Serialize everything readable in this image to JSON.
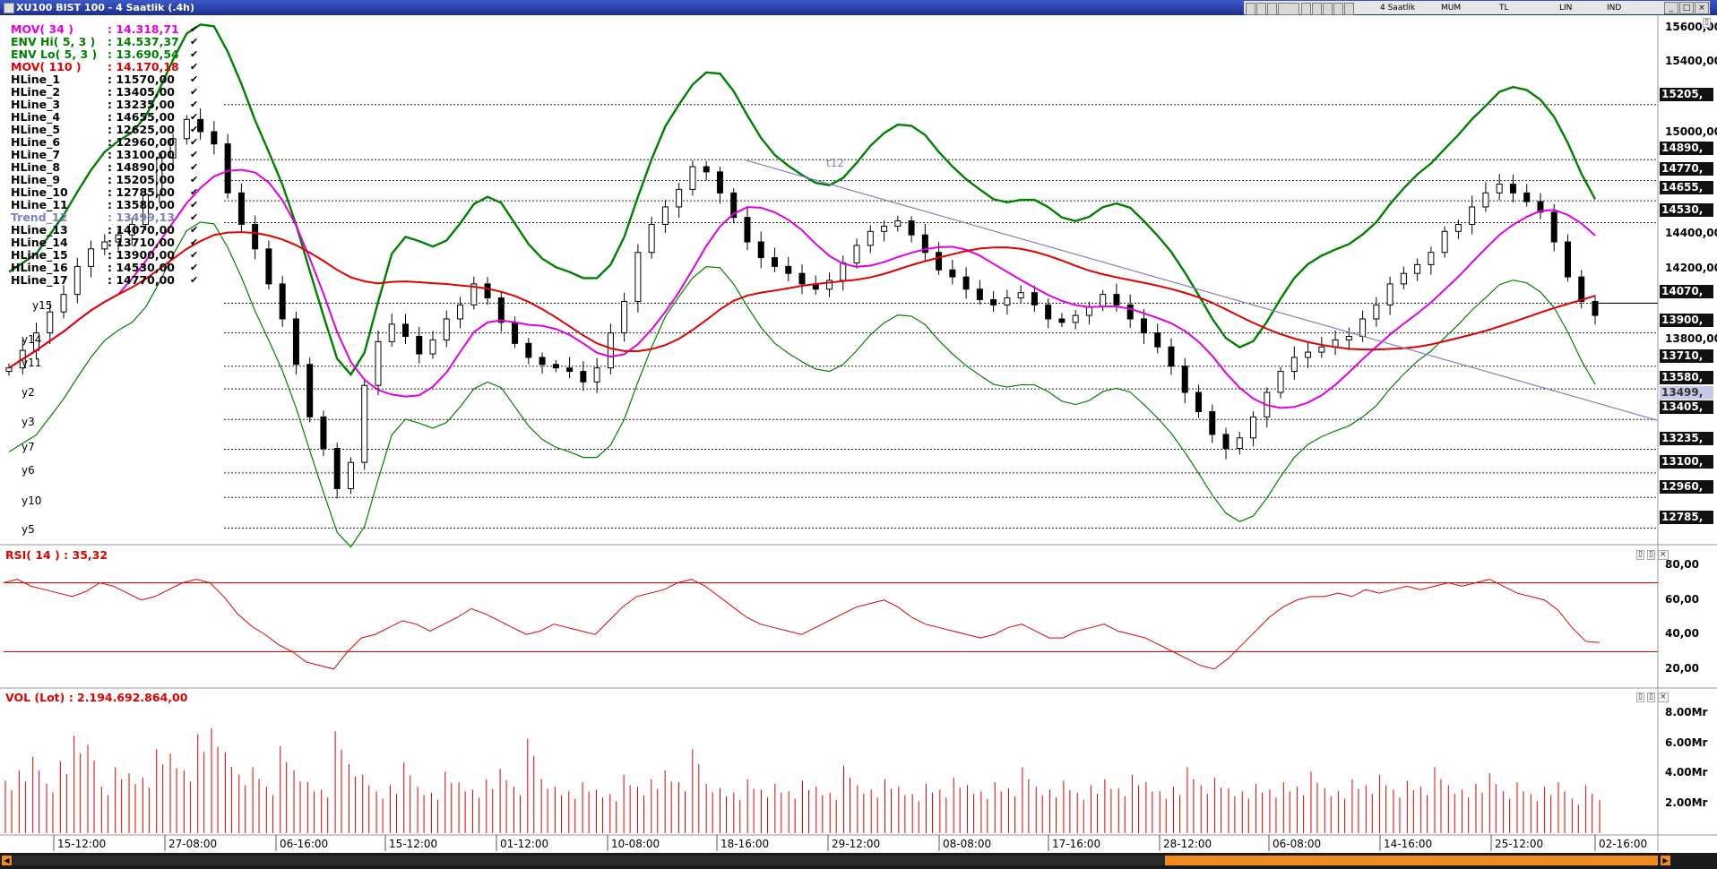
{
  "window": {
    "title": "XU100 BIST 100 - 4 Saatlik (.4h)"
  },
  "toolbar": {
    "period": "4 Saatlik",
    "style": "MUM",
    "currency": "TL",
    "scale": "LIN",
    "mode": "IND"
  },
  "legend": [
    {
      "name": "MOV( 34 )",
      "value": ": 14.318,71",
      "color": "#e000e0"
    },
    {
      "name": "ENV Hi( 5, 3 )",
      "value": ": 14.537,37",
      "color": "#008000"
    },
    {
      "name": "ENV Lo( 5, 3 )",
      "value": ": 13.690,54",
      "color": "#008000"
    },
    {
      "name": "MOV( 110 )",
      "value": ": 14.170,18",
      "color": "#e00000"
    },
    {
      "name": "HLine_1",
      "value": ": 11570,00",
      "color": "#000000"
    },
    {
      "name": "HLine_2",
      "value": ": 13405,00",
      "color": "#000000"
    },
    {
      "name": "HLine_3",
      "value": ": 13235,00",
      "color": "#000000"
    },
    {
      "name": "HLine_4",
      "value": ": 14655,00",
      "color": "#000000"
    },
    {
      "name": "HLine_5",
      "value": ": 12625,00",
      "color": "#000000"
    },
    {
      "name": "HLine_6",
      "value": ": 12960,00",
      "color": "#000000"
    },
    {
      "name": "HLine_7",
      "value": ": 13100,00",
      "color": "#000000"
    },
    {
      "name": "HLine_8",
      "value": ": 14890,00",
      "color": "#000000"
    },
    {
      "name": "HLine_9",
      "value": ": 15205,00",
      "color": "#000000"
    },
    {
      "name": "HLine_10",
      "value": ": 12785,00",
      "color": "#000000"
    },
    {
      "name": "HLine_11",
      "value": ": 13580,00",
      "color": "#000000"
    },
    {
      "name": "Trend_12",
      "value": ": 13499,13",
      "color": "#8080c0"
    },
    {
      "name": "HLine_13",
      "value": ": 14070,00",
      "color": "#000000"
    },
    {
      "name": "HLine_14",
      "value": ": 13710,00",
      "color": "#000000"
    },
    {
      "name": "HLine_15",
      "value": ": 13900,00",
      "color": "#000000"
    },
    {
      "name": "HLine_16",
      "value": ": 14530,00",
      "color": "#000000"
    },
    {
      "name": "HLine_17",
      "value": ": 14770,00",
      "color": "#000000"
    }
  ],
  "price_axis": [
    "15600,00",
    "15400,00",
    "15205,",
    "15000,00",
    "14890,",
    "14770,",
    "14655,",
    "14530,",
    "14400,00",
    "14200,00",
    "14070,",
    "13900,",
    "13800,00",
    "13710,",
    "13580,",
    "13499,",
    "13405,",
    "13235,",
    "13100,",
    "12960,",
    "12785,"
  ],
  "line_labels": [
    "y15",
    "y14",
    "y11",
    "y2",
    "y3",
    "y7",
    "y6",
    "y10",
    "y5"
  ],
  "trend_label": "t12",
  "rsi": {
    "title": "RSI( 14 ) : 35,32",
    "axis": [
      "80,00",
      "60,00",
      "40,00",
      "20,00"
    ]
  },
  "volume": {
    "title": "VOL (Lot) : 2.194.692.864,00",
    "axis": [
      "8.00Mr",
      "6.00Mr",
      "4.00Mr",
      "2.00Mr"
    ]
  },
  "time_axis": [
    "15-12:00",
    "27-08:00",
    "06-16:00",
    "15-12:00",
    "01-12:00",
    "10-08:00",
    "18-16:00",
    "29-12:00",
    "08-08:00",
    "17-16:00",
    "28-12:00",
    "06-08:00",
    "14-16:00",
    "25-12:00",
    "02-16:00"
  ],
  "chart_data": [
    {
      "type": "candlestick",
      "title": "XU100 BIST 100 - 4 Saatlik (.4h)",
      "ylim": [
        12700,
        15700
      ],
      "horizontal_lines": [
        15205,
        14890,
        14770,
        14655,
        14530,
        14070,
        13900,
        13710,
        13580,
        13405,
        13235,
        13100,
        12960,
        12785
      ],
      "trend_line": {
        "name": "Trend_12",
        "from": 14890,
        "to": 13499.13
      },
      "close_points": [
        13700,
        13800,
        13900,
        14020,
        14120,
        14280,
        14380,
        14420,
        14460,
        14520,
        14690,
        14900,
        15010,
        15120,
        15050,
        14980,
        14700,
        14520,
        14380,
        14180,
        13980,
        13720,
        13420,
        13240,
        13010,
        13160,
        13600,
        13850,
        13950,
        13880,
        13780,
        13860,
        13980,
        14060,
        14180,
        14100,
        13960,
        13840,
        13760,
        13720,
        13700,
        13680,
        13620,
        13700,
        13900,
        14080,
        14360,
        14520,
        14620,
        14720,
        14850,
        14820,
        14700,
        14560,
        14420,
        14330,
        14280,
        14240,
        14180,
        14150,
        14200,
        14300,
        14400,
        14480,
        14510,
        14540,
        14460,
        14360,
        14260,
        14220,
        14150,
        14090,
        14060,
        14100,
        14130,
        14060,
        13980,
        13960,
        14000,
        14050,
        14120,
        14060,
        13980,
        13900,
        13820,
        13710,
        13560,
        13450,
        13320,
        13240,
        13300,
        13420,
        13560,
        13680,
        13760,
        13790,
        13820,
        13860,
        13880,
        13980,
        14060,
        14180,
        14240,
        14290,
        14360,
        14480,
        14520,
        14620,
        14700,
        14750,
        14700,
        14650,
        14590,
        14420,
        14220,
        14080,
        14000
      ],
      "series": [
        {
          "name": "MOV( 34 )",
          "last": 14318.71
        },
        {
          "name": "ENV Hi( 5, 3 )",
          "last": 14537.37
        },
        {
          "name": "ENV Lo( 5, 3 )",
          "last": 13690.54
        },
        {
          "name": "MOV( 110 )",
          "last": 14170.18
        }
      ]
    },
    {
      "type": "line",
      "title": "RSI( 14 ) : 35,32",
      "ylim": [
        10,
        90
      ],
      "reference_lines": [
        70,
        30
      ],
      "values": [
        70,
        72,
        68,
        66,
        64,
        62,
        65,
        70,
        68,
        64,
        60,
        62,
        66,
        70,
        72,
        70,
        62,
        52,
        45,
        40,
        34,
        30,
        24,
        22,
        20,
        30,
        38,
        40,
        44,
        48,
        46,
        42,
        46,
        50,
        55,
        52,
        48,
        44,
        40,
        42,
        46,
        44,
        42,
        40,
        48,
        56,
        62,
        64,
        66,
        70,
        72,
        68,
        62,
        56,
        50,
        46,
        44,
        42,
        40,
        44,
        48,
        52,
        56,
        58,
        60,
        56,
        50,
        46,
        44,
        42,
        40,
        38,
        40,
        44,
        46,
        42,
        38,
        38,
        42,
        44,
        46,
        42,
        40,
        38,
        34,
        30,
        26,
        22,
        20,
        26,
        34,
        42,
        50,
        56,
        60,
        62,
        62,
        64,
        62,
        66,
        64,
        66,
        68,
        66,
        68,
        70,
        68,
        70,
        72,
        68,
        64,
        62,
        60,
        54,
        44,
        36,
        35.32
      ]
    },
    {
      "type": "bar",
      "title": "VOL (Lot) : 2.194.692.864,00",
      "ylim": [
        0,
        9.5
      ],
      "values": [
        3.5,
        4.2,
        5.1,
        3.3,
        4.8,
        6.5,
        5.9,
        3.1,
        4.4,
        4.0,
        3.7,
        5.6,
        5.3,
        4.2,
        6.6,
        7.0,
        5.4,
        3.9,
        4.4,
        3.1,
        5.8,
        4.2,
        3.4,
        2.9,
        6.8,
        4.6,
        3.9,
        2.8,
        3.2,
        4.7,
        3.1,
        2.7,
        4.1,
        3.4,
        2.9,
        3.6,
        4.3,
        3.1,
        6.3,
        3.6,
        3.1,
        2.8,
        3.4,
        2.9,
        2.6,
        3.9,
        3.1,
        3.6,
        4.2,
        3.4,
        5.6,
        3.3,
        3.0,
        2.7,
        3.6,
        2.9,
        3.3,
        2.8,
        3.5,
        3.1,
        2.7,
        4.5,
        3.2,
        2.9,
        3.6,
        3.1,
        2.6,
        3.3,
        2.9,
        3.7,
        3.2,
        2.8,
        3.4,
        3.0,
        4.4,
        3.1,
        2.9,
        3.5,
        2.7,
        3.2,
        3.6,
        3.0,
        3.9,
        3.4,
        2.8,
        3.1,
        4.4,
        3.2,
        3.7,
        3.0,
        2.8,
        3.3,
        2.9,
        3.4,
        3.1,
        4.1,
        3.0,
        2.8,
        3.6,
        3.2,
        3.9,
        2.9,
        3.5,
        3.1,
        4.4,
        3.2,
        2.9,
        3.3,
        4.0,
        2.8,
        3.4,
        2.6,
        3.1,
        3.4,
        2.3,
        3.2,
        2.2
      ]
    }
  ]
}
